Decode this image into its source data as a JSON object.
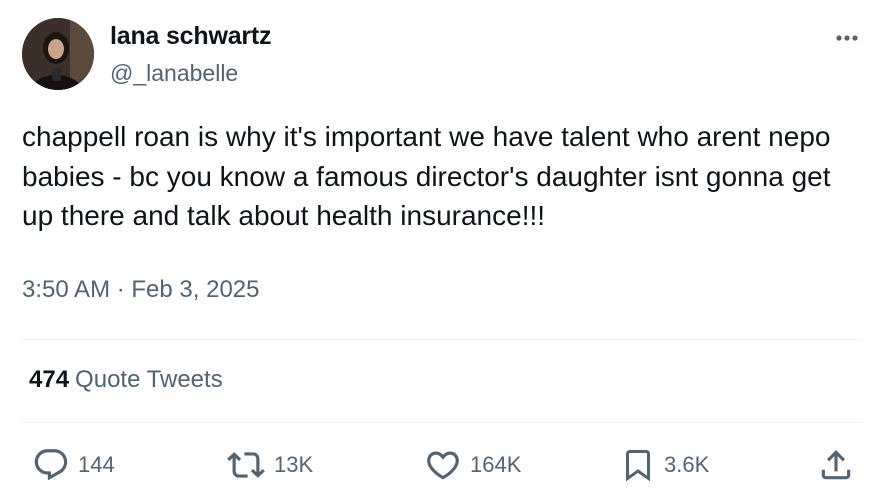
{
  "author": {
    "display_name": "lana schwartz",
    "handle": "@_lanabelle"
  },
  "tweet": {
    "text": "chappell roan is why it's important we have talent who arent nepo babies - bc you know a famous director's daughter isnt gonna get up there and talk about health insurance!!!",
    "timestamp": "3:50 AM · Feb 3, 2025"
  },
  "quote_tweets": {
    "count": "474",
    "label": "Quote Tweets"
  },
  "actions": {
    "replies": "144",
    "retweets": "13K",
    "likes": "164K",
    "bookmarks": "3.6K"
  },
  "icons": {
    "more": "more-options-icon",
    "reply": "reply-icon",
    "retweet": "retweet-icon",
    "like": "heart-icon",
    "bookmark": "bookmark-icon",
    "share": "share-icon"
  },
  "colors": {
    "text_primary": "#0f1419",
    "text_secondary": "#536471",
    "divider": "#eff3f4"
  }
}
